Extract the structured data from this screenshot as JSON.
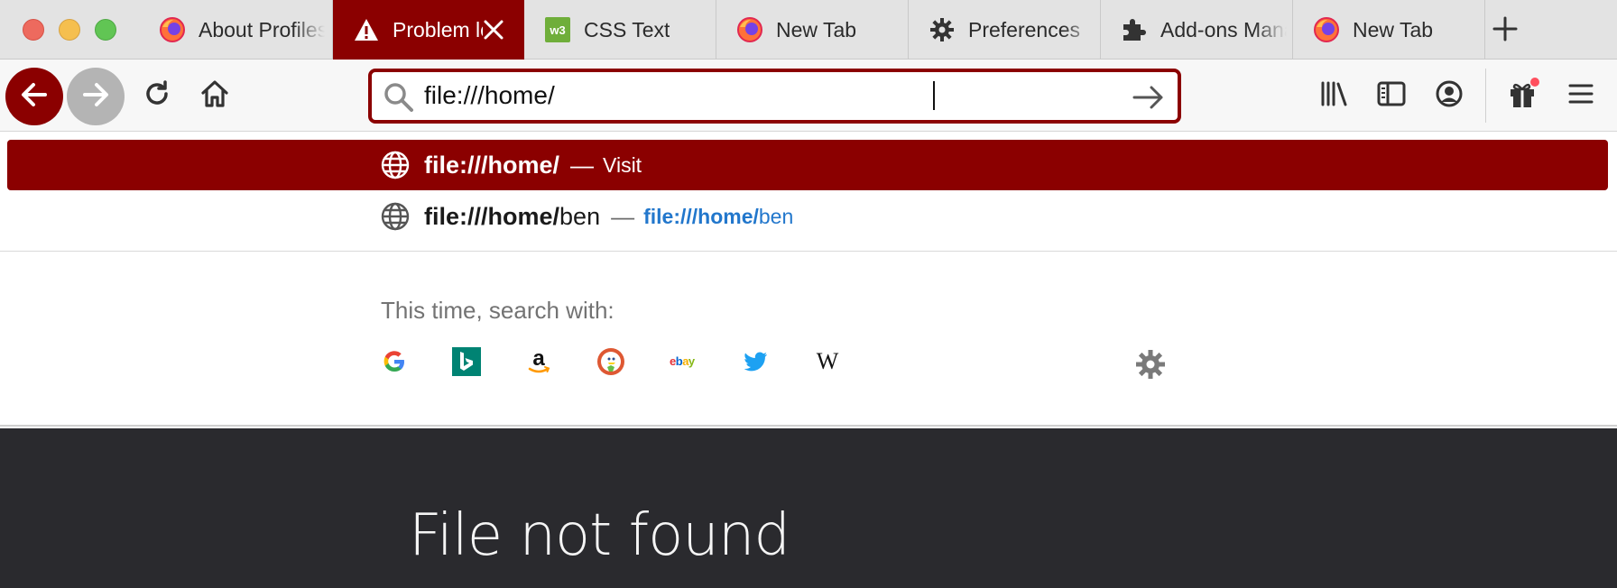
{
  "tabs": [
    {
      "title": "About Profiles",
      "icon": "firefox-icon",
      "active": false
    },
    {
      "title": "Problem loading page",
      "icon": "warning-icon",
      "active": true
    },
    {
      "title": "CSS Text",
      "icon": "w3c-icon",
      "active": false
    },
    {
      "title": "New Tab",
      "icon": "firefox-icon",
      "active": false
    },
    {
      "title": "Preferences",
      "icon": "gear-icon",
      "active": false
    },
    {
      "title": "Add-ons Manager",
      "icon": "puzzle-icon",
      "active": false
    },
    {
      "title": "New Tab",
      "icon": "firefox-icon",
      "active": false
    }
  ],
  "urlbar": {
    "value": "file:///home/"
  },
  "suggestions": [
    {
      "match": "file:///home/",
      "rest": "",
      "separator": "—",
      "action": "Visit",
      "selected": true
    },
    {
      "match": "file:///home/",
      "rest": "ben",
      "separator": "—",
      "url_match": "file:///home/",
      "url_rest": "ben",
      "selected": false
    }
  ],
  "search_with": {
    "label": "This time, search with:",
    "engines": [
      "Google",
      "Bing",
      "Amazon",
      "DuckDuckGo",
      "eBay",
      "Twitter",
      "Wikipedia"
    ]
  },
  "page": {
    "heading": "File not found"
  },
  "colors": {
    "accent": "#8b0000",
    "link": "#2277cc",
    "page_bg": "#2a2a2e",
    "tabstrip_bg": "#e3e3e3"
  }
}
